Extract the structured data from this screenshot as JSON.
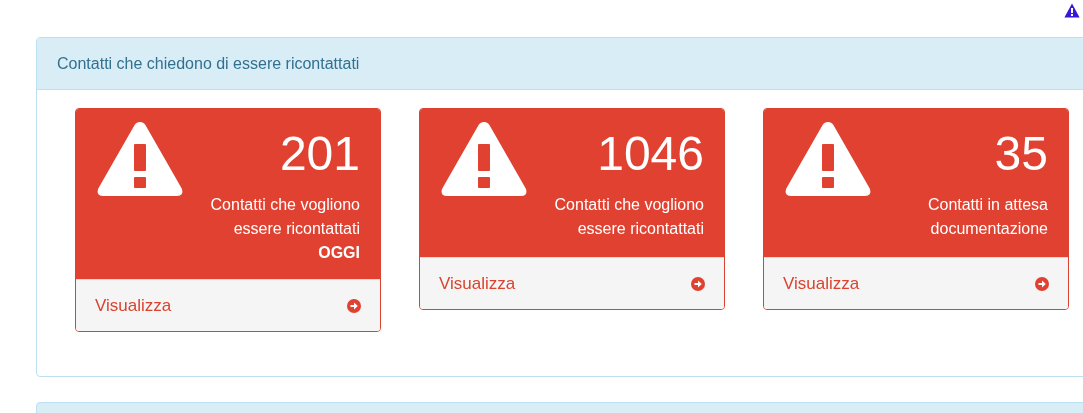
{
  "panel": {
    "title": "Contatti che chiedono di essere ricontattati"
  },
  "cards": [
    {
      "count": "201",
      "label": "Contatti che vogliono essere ricontattati",
      "highlight": "OGGI",
      "link": "Visualizza"
    },
    {
      "count": "1046",
      "label": "Contatti che vogliono essere ricontattati",
      "link": "Visualizza"
    },
    {
      "count": "35",
      "label": "Contatti in attesa documentazione",
      "link": "Visualizza"
    }
  ]
}
